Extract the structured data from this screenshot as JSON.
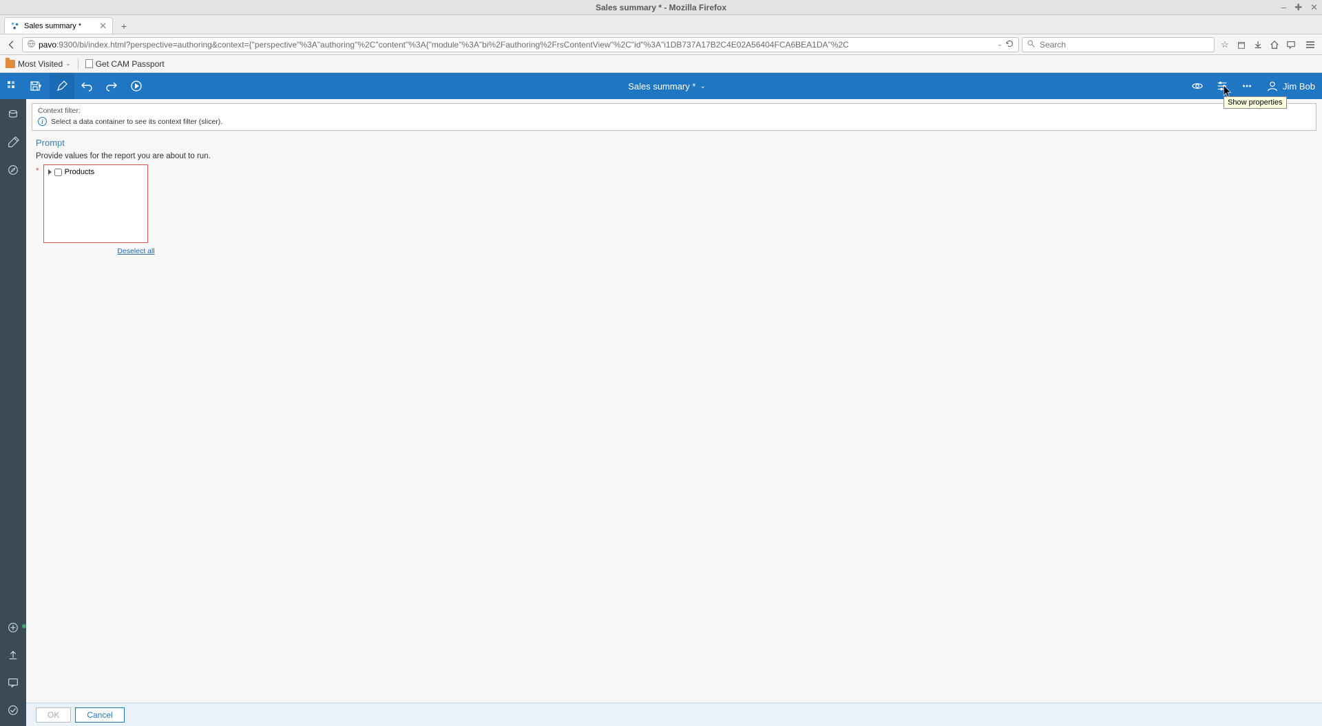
{
  "os": {
    "title": "Sales summary * - Mozilla Firefox",
    "min": "–",
    "max": "✚",
    "close": "✕"
  },
  "tab": {
    "title": "Sales summary *"
  },
  "url": {
    "host": "pavo",
    "path": ":9300/bi/index.html?perspective=authoring&context={\"perspective\"%3A\"authoring\"%2C\"content\"%3A{\"module\"%3A\"bi%2Fauthoring%2FrsContentView\"%2C\"id\"%3A\"i1DB737A17B2C4E02A56404FCA6BEA1DA\"%2C",
    "search_placeholder": "Search"
  },
  "bookmarks": {
    "most_visited": "Most Visited",
    "cam": "Get CAM Passport"
  },
  "app": {
    "doc_title": "Sales summary *",
    "user": "Jim Bob",
    "tooltip_properties": "Show properties"
  },
  "context_filter": {
    "label": "Context filter:",
    "message": "Select a data container to see its context filter (slicer)."
  },
  "prompt": {
    "title": "Prompt",
    "subtitle": "Provide values for the report you are about to run.",
    "tree_root": "Products",
    "deselect": "Deselect all"
  },
  "footer": {
    "ok": "OK",
    "cancel": "Cancel"
  }
}
